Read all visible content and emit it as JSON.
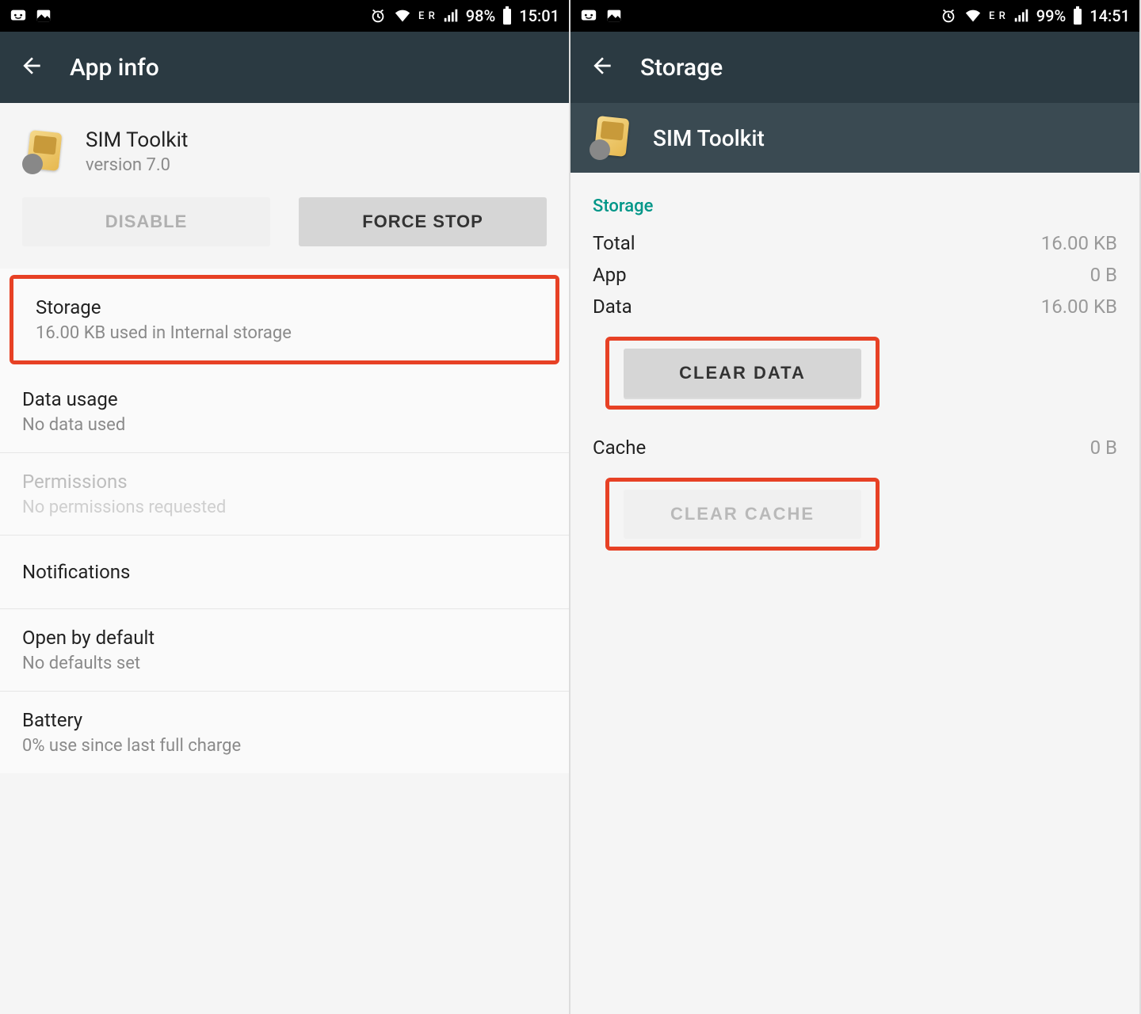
{
  "left": {
    "statusbar": {
      "network_label": "E R",
      "battery_pct": "98%",
      "time": "15:01"
    },
    "header": {
      "title": "App info"
    },
    "app": {
      "name": "SIM Toolkit",
      "version": "version 7.0"
    },
    "buttons": {
      "disable": "DISABLE",
      "force_stop": "FORCE STOP"
    },
    "rows": {
      "storage": {
        "title": "Storage",
        "subtitle": "16.00 KB used in Internal storage"
      },
      "data_usage": {
        "title": "Data usage",
        "subtitle": "No data used"
      },
      "permissions": {
        "title": "Permissions",
        "subtitle": "No permissions requested"
      },
      "notifications": {
        "title": "Notifications"
      },
      "open_by_default": {
        "title": "Open by default",
        "subtitle": "No defaults set"
      },
      "battery": {
        "title": "Battery",
        "subtitle": "0% use since last full charge"
      }
    }
  },
  "right": {
    "statusbar": {
      "network_label": "E R",
      "battery_pct": "99%",
      "time": "14:51"
    },
    "header": {
      "title": "Storage"
    },
    "app": {
      "name": "SIM Toolkit"
    },
    "section_label": "Storage",
    "storage": {
      "total": {
        "label": "Total",
        "value": "16.00 KB"
      },
      "app": {
        "label": "App",
        "value": "0 B"
      },
      "data": {
        "label": "Data",
        "value": "16.00 KB"
      }
    },
    "cache": {
      "label": "Cache",
      "value": "0 B"
    },
    "buttons": {
      "clear_data": "CLEAR DATA",
      "clear_cache": "CLEAR CACHE"
    }
  }
}
